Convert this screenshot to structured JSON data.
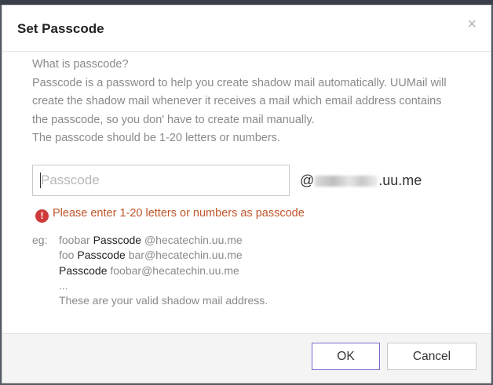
{
  "dialog": {
    "title": "Set Passcode",
    "close_glyph": "×",
    "description": [
      "What is passcode?",
      "Passcode is a password to help you create shadow mail automatically. UUMail will",
      "create the shadow mail whenever it receives a mail which email address contains",
      "the passcode, so you don' have to create mail manually.",
      "The passcode should be 1-20 letters or numbers."
    ],
    "passcode_input": {
      "placeholder": "Passcode",
      "value": ""
    },
    "domain_prefix": "@",
    "domain_suffix": ".uu.me",
    "error": {
      "icon_glyph": "!",
      "text": "Please enter 1-20 letters or numbers as passcode"
    },
    "examples": {
      "label": "eg:",
      "lines": [
        {
          "pre": "foobar ",
          "hl": "Passcode",
          "post": " @hecatechin.uu.me"
        },
        {
          "pre": "foo ",
          "hl": "Passcode",
          "post": " bar@hecatechin.uu.me"
        },
        {
          "pre": "",
          "hl": "Passcode",
          "post": " foobar@hecatechin.uu.me"
        }
      ],
      "ellipsis": "...",
      "note": "These are your valid shadow mail address."
    },
    "buttons": {
      "ok": "OK",
      "cancel": "Cancel"
    }
  },
  "colors": {
    "accent_border": "#7b6bd1",
    "error_text": "#c0562b",
    "error_icon": "#cf3b3b"
  },
  "icons": {
    "close": "close-icon",
    "error": "error-icon",
    "redacted": "redacted-blur"
  }
}
